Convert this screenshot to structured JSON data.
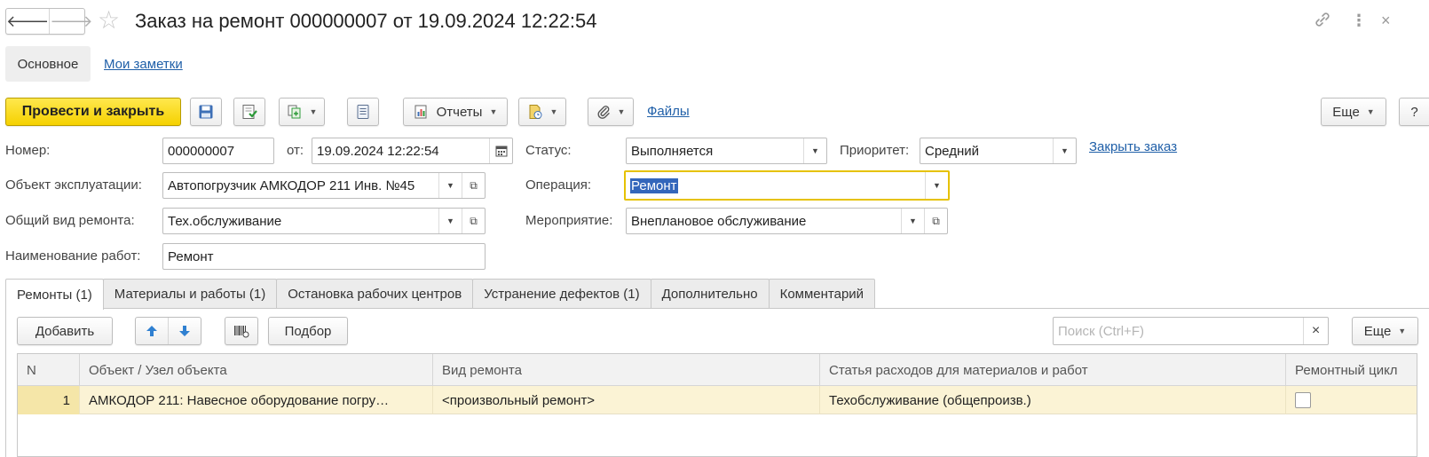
{
  "window": {
    "title": "Заказ на ремонт 000000007 от 19.09.2024 12:22:54",
    "back_icon": "arrow-left-icon",
    "forward_icon": "arrow-right-icon"
  },
  "sections": {
    "main": "Основное",
    "notes": "Мои заметки"
  },
  "toolbar": {
    "post_close": "Провести и закрыть",
    "reports": "Отчеты",
    "files": "Файлы",
    "more": "Еще",
    "help": "?"
  },
  "form": {
    "number_label": "Номер:",
    "number_value": "000000007",
    "from_label": "от:",
    "date_value": "19.09.2024 12:22:54",
    "status_label": "Статус:",
    "status_value": "Выполняется",
    "priority_label": "Приоритет:",
    "priority_value": "Средний",
    "close_order": "Закрыть заказ",
    "object_label": "Объект эксплуатации:",
    "object_value": "Автопогрузчик АМКОДОР 211 Инв. №45",
    "operation_label": "Операция:",
    "operation_value": "Ремонт",
    "repair_kind_label": "Общий вид ремонта:",
    "repair_kind_value": "Тех.обслуживание",
    "event_label": "Мероприятие:",
    "event_value": "Внеплановое обслуживание",
    "work_name_label": "Наименование работ:",
    "work_name_value": "Ремонт"
  },
  "tabs": [
    "Ремонты (1)",
    "Материалы и работы (1)",
    "Остановка рабочих центров",
    "Устранение дефектов (1)",
    "Дополнительно",
    "Комментарий"
  ],
  "table_toolbar": {
    "add": "Добавить",
    "selection": "Подбор",
    "search_placeholder": "Поиск (Ctrl+F)",
    "clear": "×",
    "more": "Еще"
  },
  "table": {
    "columns": [
      "N",
      "Объект / Узел объекта",
      "Вид ремонта",
      "Статья расходов для материалов и работ",
      "Ремонтный цикл"
    ],
    "rows": [
      {
        "n": "1",
        "object": "АМКОДОР 211: Навесное оборудование погру…",
        "repair_kind": "<произвольный ремонт>",
        "expense": "Техобслуживание (общепроизв.)",
        "cycle": false
      }
    ]
  }
}
